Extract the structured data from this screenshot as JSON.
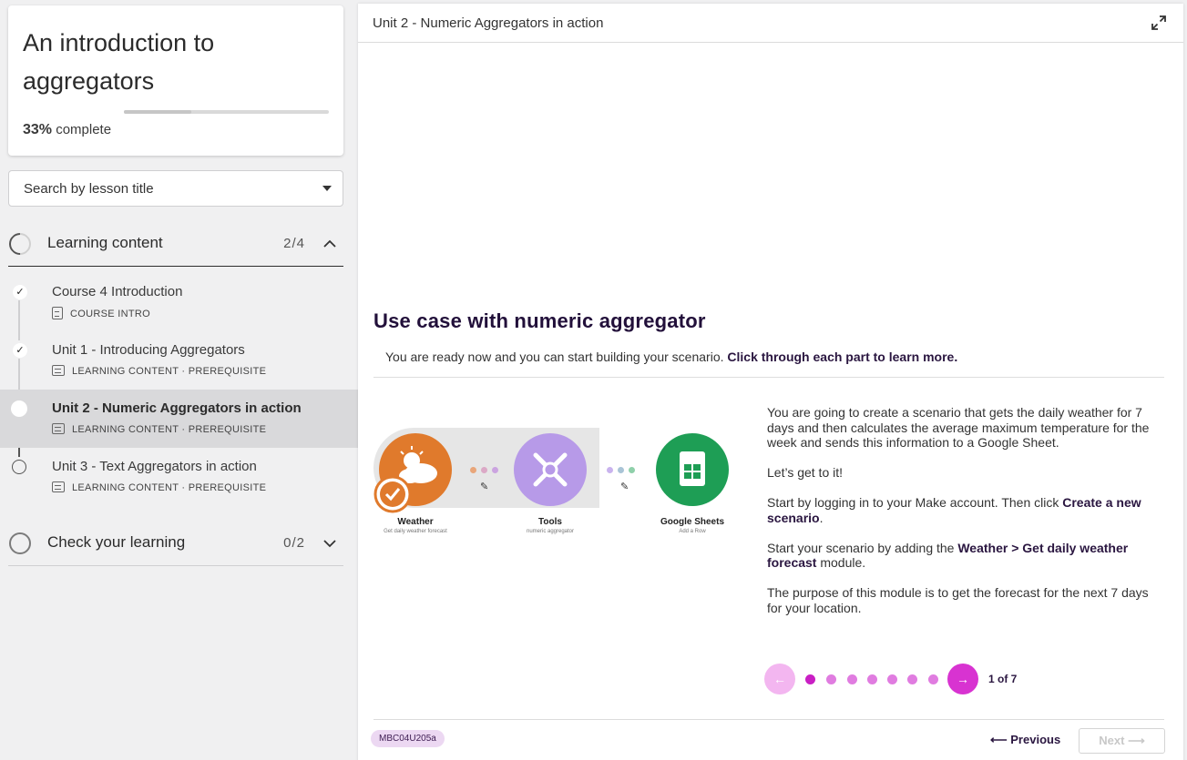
{
  "course": {
    "title": "An introduction to aggregators",
    "progress_pct": "33%",
    "progress_label": "complete",
    "progress_value": 0.33
  },
  "search": {
    "placeholder": "Search by lesson title"
  },
  "sections": [
    {
      "title": "Learning content",
      "count": "2/4",
      "lessons": [
        {
          "title": "Course 4 Introduction",
          "meta": "COURSE INTRO"
        },
        {
          "title": "Unit 1 - Introducing Aggregators",
          "meta": "LEARNING CONTENT · PREREQUISITE"
        },
        {
          "title": "Unit 2 - Numeric Aggregators in action",
          "meta": "LEARNING CONTENT · PREREQUISITE"
        },
        {
          "title": "Unit 3 - Text Aggregators in action",
          "meta": "LEARNING CONTENT · PREREQUISITE"
        }
      ]
    },
    {
      "title": "Check your learning",
      "count": "0/2"
    }
  ],
  "main": {
    "header_title": "Unit 2 - Numeric Aggregators in action",
    "heading": "Use case with numeric aggregator",
    "subtitle_plain": "You are ready now and you can start building your scenario. ",
    "subtitle_bold": "Click through each part to learn more.",
    "modules": [
      {
        "name": "Weather",
        "desc": "Get daily weather forecast",
        "color": "#e07a2c"
      },
      {
        "name": "Tools",
        "desc": "numeric aggregator",
        "color": "#b79ae8"
      },
      {
        "name": "Google Sheets",
        "desc": "Add a Row",
        "color": "#1e9e55"
      }
    ],
    "body": {
      "p1": "You are going to create a scenario that gets the daily weather for 7 days and then calculates the average maximum temperature for the week and sends this information to a Google Sheet.",
      "p2": "Let’s get to it!",
      "p3_a": "Start by logging in to your Make account. Then click ",
      "p3_b": "Create a new scenario",
      "p3_c": ".",
      "p4_a": "Start your scenario by adding the ",
      "p4_b": "Weather > Get daily weather forecast",
      "p4_c": " module.",
      "p5": "The purpose of this module is to get the forecast for the next 7 days for your location."
    },
    "carousel": {
      "counter": "1 of 7",
      "current": 1,
      "total": 7
    },
    "footer": {
      "badge": "MBC04U205a",
      "previous_label": "Previous",
      "next_label": "Next"
    }
  },
  "colors": {
    "accent": "#d833d1",
    "heading": "#22103a"
  }
}
